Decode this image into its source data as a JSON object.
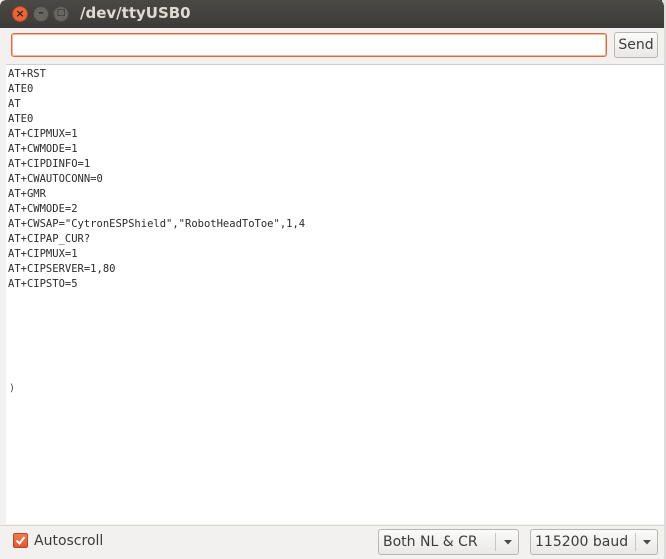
{
  "window": {
    "title": "/dev/ttyUSB0"
  },
  "titlebar": {
    "close_glyph": "×",
    "minimize_glyph": "–",
    "maximize_glyph": "□"
  },
  "input": {
    "value": "",
    "placeholder": ""
  },
  "send_label": "Send",
  "console_lines": [
    "AT+RST",
    "ATE0",
    "AT",
    "ATE0",
    "AT+CIPMUX=1",
    "AT+CWMODE=1",
    "AT+CIPDINFO=1",
    "AT+CWAUTOCONN=0",
    "AT+GMR",
    "AT+CWMODE=2",
    "AT+CWSAP=\"CytronESPShield\",\"RobotHeadToToe\",1,4",
    "AT+CIPAP_CUR?",
    "AT+CIPMUX=1",
    "AT+CIPSERVER=1,80",
    "AT+CIPSTO=5"
  ],
  "stray_glyph": ")",
  "footer": {
    "autoscroll": {
      "label": "Autoscroll",
      "checked": true
    },
    "line_ending": {
      "selected": "Both NL & CR"
    },
    "baud_rate": {
      "selected": "115200 baud"
    }
  },
  "colors": {
    "accent": "#e9663a",
    "titlebar": "#3c3b37"
  }
}
